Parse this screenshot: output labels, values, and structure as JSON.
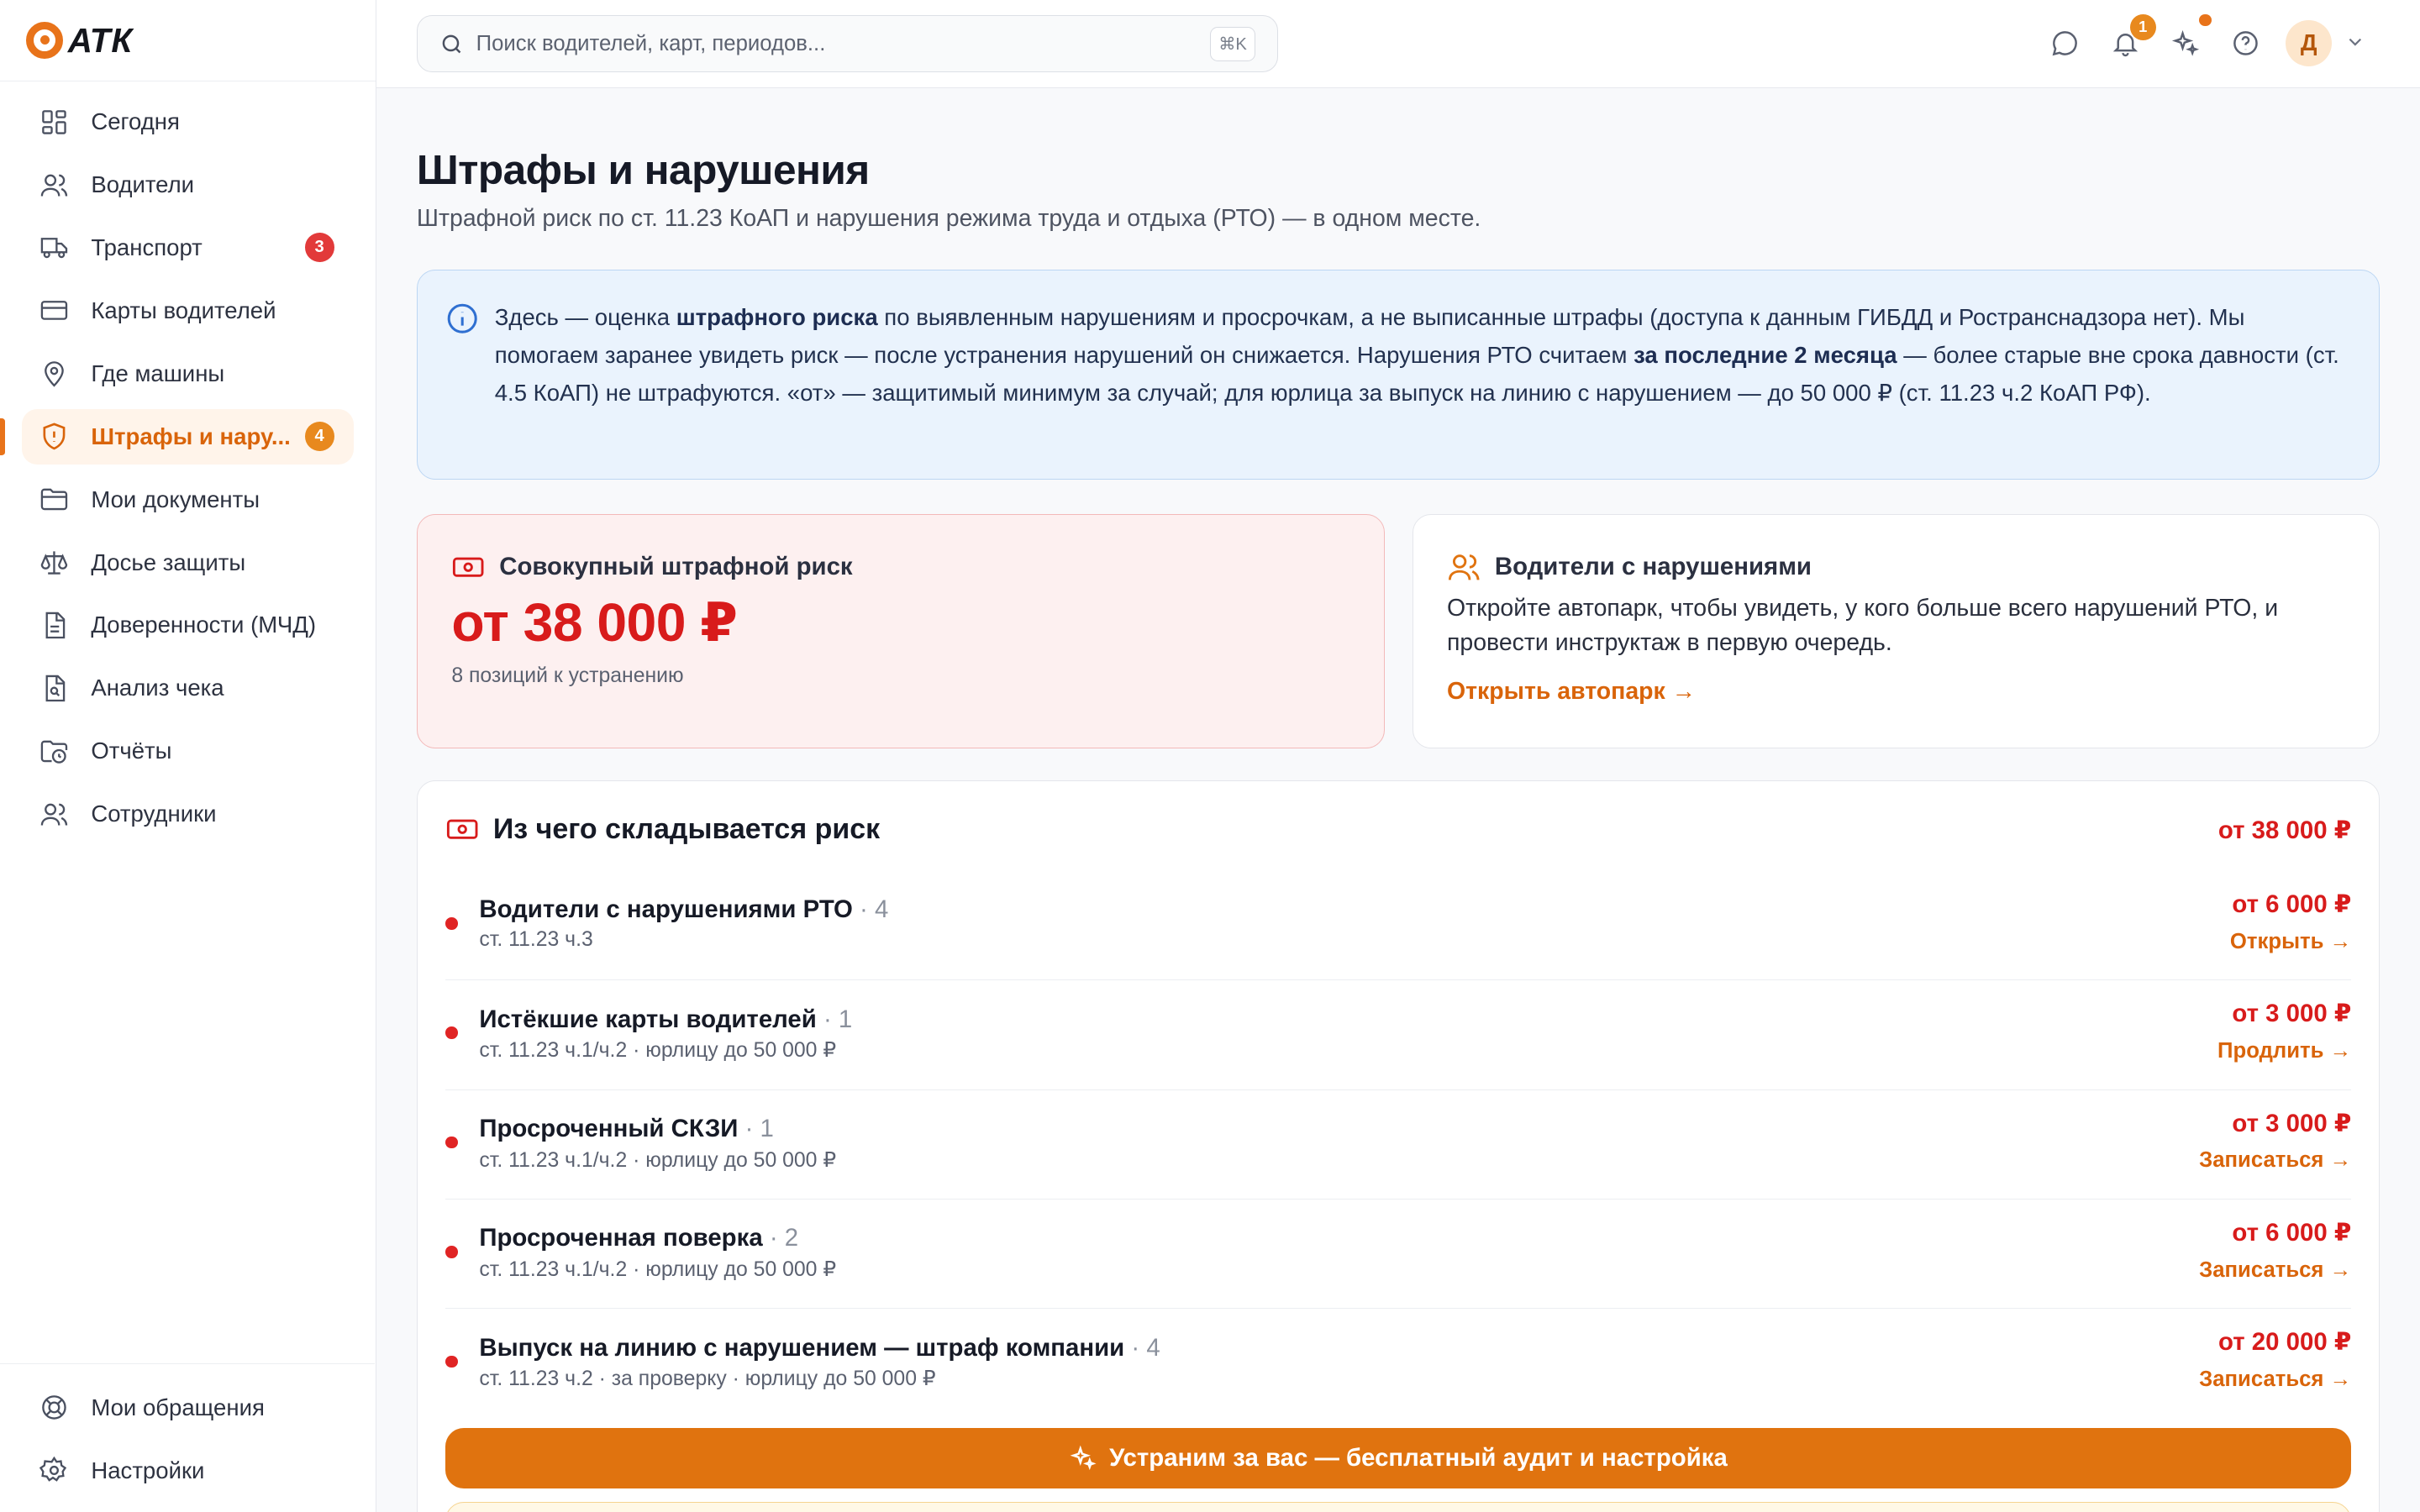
{
  "app": {
    "logo_text": "АТК"
  },
  "sidebar": {
    "items": [
      {
        "label": "Сегодня",
        "icon": "dashboard-icon"
      },
      {
        "label": "Водители",
        "icon": "users-icon"
      },
      {
        "label": "Транспорт",
        "icon": "truck-icon",
        "badge": "3"
      },
      {
        "label": "Карты водителей",
        "icon": "card-icon"
      },
      {
        "label": "Где машины",
        "icon": "map-pin-icon"
      },
      {
        "label": "Штрафы и нару...",
        "icon": "shield-alert-icon",
        "badge": "4",
        "active": true
      },
      {
        "label": "Мои документы",
        "icon": "folder-icon"
      },
      {
        "label": "Досье защиты",
        "icon": "scales-icon"
      },
      {
        "label": "Доверенности (МЧД)",
        "icon": "document-icon"
      },
      {
        "label": "Анализ чека",
        "icon": "file-search-icon"
      },
      {
        "label": "Отчёты",
        "icon": "folder-clock-icon"
      },
      {
        "label": "Сотрудники",
        "icon": "users-icon"
      }
    ],
    "bottom": [
      {
        "label": "Мои обращения",
        "icon": "lifebuoy-icon"
      },
      {
        "label": "Настройки",
        "icon": "gear-icon"
      }
    ]
  },
  "topbar": {
    "search_placeholder": "Поиск водителей, карт, периодов...",
    "shortcut": "⌘K",
    "notifications_count": "1",
    "avatar_letter": "Д"
  },
  "page": {
    "title": "Штрафы и нарушения",
    "subtitle": "Штрафной риск по ст. 11.23 КоАП и нарушения режима труда и отдыха (РТО) — в одном месте."
  },
  "info": {
    "t1": "Здесь — оценка ",
    "b1": "штрафного риска",
    "t2": " по выявленным нарушениям и просрочкам, а не выписанные штрафы (доступа к данным ГИБДД и Ространснадзора нет). Мы помогаем заранее увидеть риск — после устранения нарушений он снижается. Нарушения РТО считаем ",
    "b2": "за последние 2 месяца",
    "t3": " — более старые вне срока давности (ст. 4.5 КоАП) не штрафуются. «от» — защитимый минимум за случай; для юрлица за выпуск на линию с нарушением — до 50 000 ₽ (ст. 11.23 ч.2 КоАП РФ)."
  },
  "risk_card": {
    "title": "Совокупный штрафной риск",
    "amount": "от 38 000 ₽",
    "note": "8 позиций к устранению"
  },
  "drivers_card": {
    "title": "Водители с нарушениями",
    "text": "Откройте автопарк, чтобы увидеть, у кого больше всего нарушений РТО, и провести инструктаж в первую очередь.",
    "link": "Открыть автопарк →"
  },
  "breakdown": {
    "title": "Из чего складывается риск",
    "total": "от 38 000 ₽",
    "rows": [
      {
        "title": "Водители с нарушениями РТО",
        "count": " · 4",
        "sub": "ст. 11.23 ч.3",
        "amount": "от 6 000 ₽",
        "action": "Открыть →"
      },
      {
        "title": "Истёкшие карты водителей",
        "count": " · 1",
        "sub": "ст. 11.23 ч.1/ч.2 · юрлицу до 50 000 ₽",
        "amount": "от 3 000 ₽",
        "action": "Продлить →"
      },
      {
        "title": "Просроченный СКЗИ",
        "count": " · 1",
        "sub": "ст. 11.23 ч.1/ч.2 · юрлицу до 50 000 ₽",
        "amount": "от 3 000 ₽",
        "action": "Записаться →"
      },
      {
        "title": "Просроченная поверка",
        "count": " · 2",
        "sub": "ст. 11.23 ч.1/ч.2 · юрлицу до 50 000 ₽",
        "amount": "от 6 000 ₽",
        "action": "Записаться →"
      },
      {
        "title": "Выпуск на линию с нарушением — штраф компании",
        "count": " · 4",
        "sub": "ст. 11.23 ч.2 · за проверку · юрлицу до 50 000 ₽",
        "amount": "от 20 000 ₽",
        "action": "Записаться →"
      }
    ],
    "cta": "Устраним за вас — бесплатный аудит и настройка"
  },
  "colors": {
    "accent": "#e0730f",
    "danger": "#d81b1b",
    "info_bg": "#eaf3fd"
  }
}
